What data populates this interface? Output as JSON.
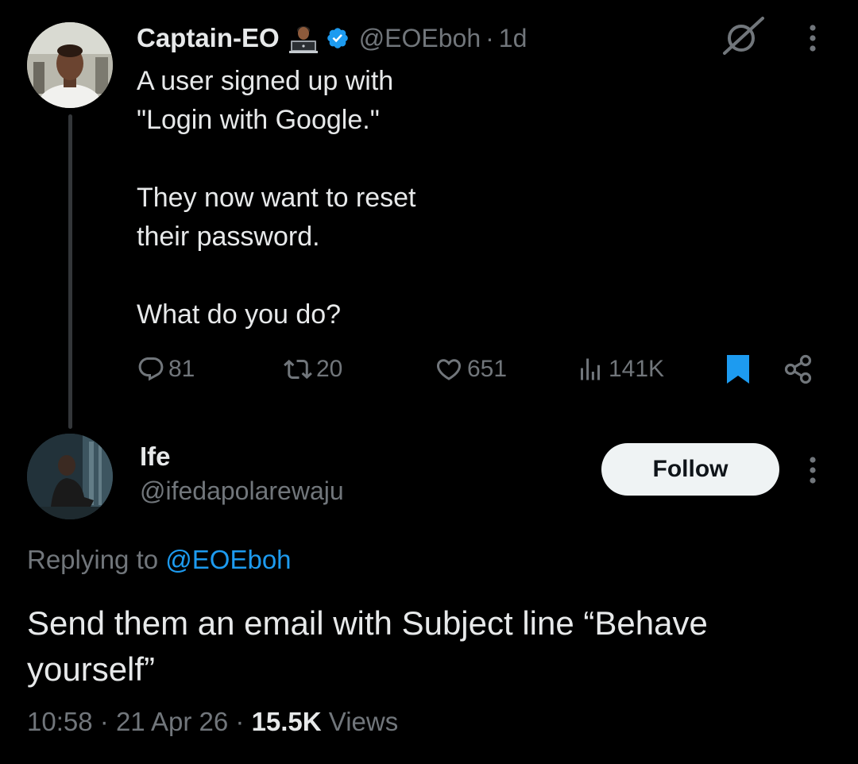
{
  "parent_tweet": {
    "display_name": "Captain-EO",
    "handle": "@EOEboh",
    "separator": "·",
    "time": "1d",
    "text_lines": [
      "A user signed up with",
      "\"Login with Google.\"",
      "",
      "They now want to reset",
      "their password.",
      "",
      "What do you do?"
    ],
    "actions": {
      "replies": "81",
      "reposts": "20",
      "likes": "651",
      "views": "141K"
    },
    "icons": {
      "emoji": "technologist-emoji-icon",
      "verified": "verified-badge-icon",
      "grok": "grok-icon",
      "more": "more-icon",
      "reply": "reply-icon",
      "repost": "repost-icon",
      "like": "heart-icon",
      "views": "views-icon",
      "bookmark": "bookmark-icon",
      "share": "share-icon"
    }
  },
  "reply_tweet": {
    "display_name": "Ife",
    "handle": "@ifedapolarewaju",
    "follow_label": "Follow",
    "replying_prefix": "Replying to",
    "replying_mention": "@EOEboh",
    "text": "Send them an email with Subject line “Behave yourself”",
    "time": "10:58",
    "separator": "·",
    "date": "21 Apr 26",
    "views_count": "15.5K",
    "views_label": "Views"
  },
  "colors": {
    "background": "#000000",
    "text_primary": "#e7e9ea",
    "text_secondary": "#71767b",
    "accent": "#1d9bf0",
    "bookmark_active": "#1d9bf0"
  }
}
